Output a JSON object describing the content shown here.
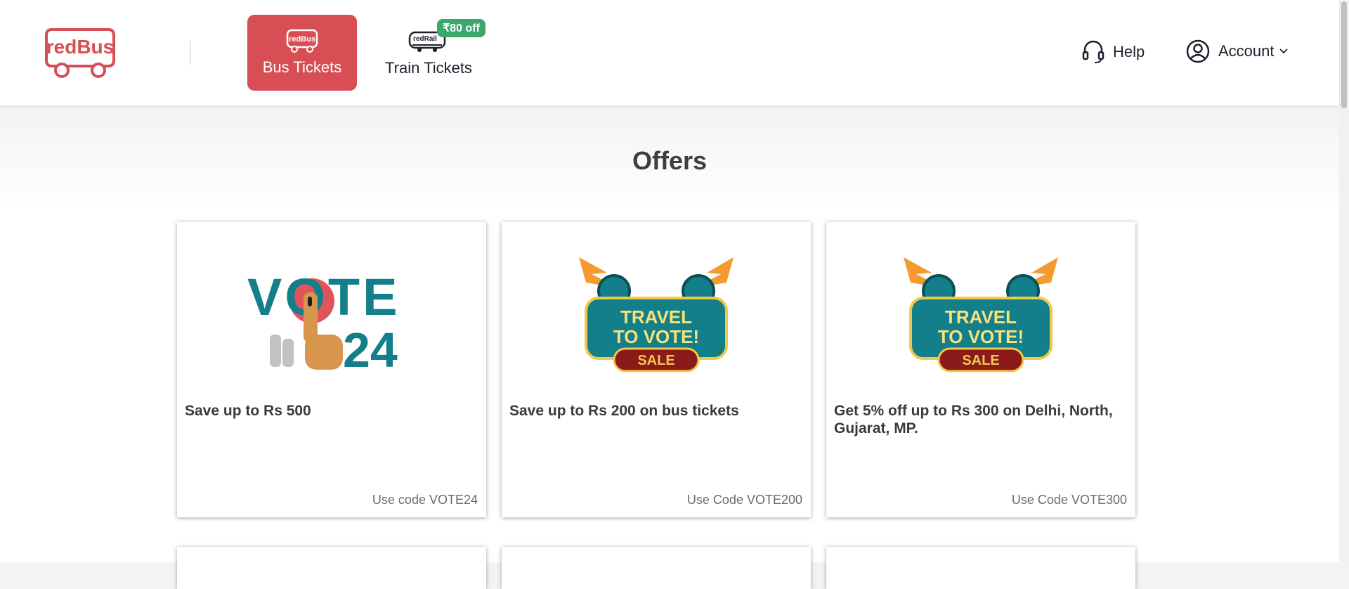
{
  "header": {
    "logo_text": "redBus",
    "nav": {
      "bus_label": "Bus Tickets",
      "bus_icon_text": "redBus",
      "train_label": "Train Tickets",
      "train_icon_text": "redRail",
      "train_badge": "₹80 off"
    },
    "help_label": "Help",
    "account_label": "Account"
  },
  "page": {
    "title": "Offers"
  },
  "offers": [
    {
      "description": "Save up to Rs 500",
      "code_text": "Use code VOTE24",
      "art_top": "VOTE",
      "art_bottom": "24"
    },
    {
      "description": "Save up to Rs 200 on bus tickets",
      "code_text": "Use Code VOTE200",
      "art_line1": "TRAVEL",
      "art_line2": "TO VOTE!",
      "art_sale": "SALE"
    },
    {
      "description": "Get 5% off up to Rs 300 on Delhi, North, Gujarat, MP.",
      "code_text": "Use Code VOTE300",
      "art_line1": "TRAVEL",
      "art_line2": "TO VOTE!",
      "art_sale": "SALE"
    }
  ],
  "colors": {
    "brand_red": "#d84e55",
    "badge_green": "#3aa76d",
    "teal": "#127f8a",
    "maroon": "#8b1a1a",
    "gold": "#f2c84b"
  }
}
